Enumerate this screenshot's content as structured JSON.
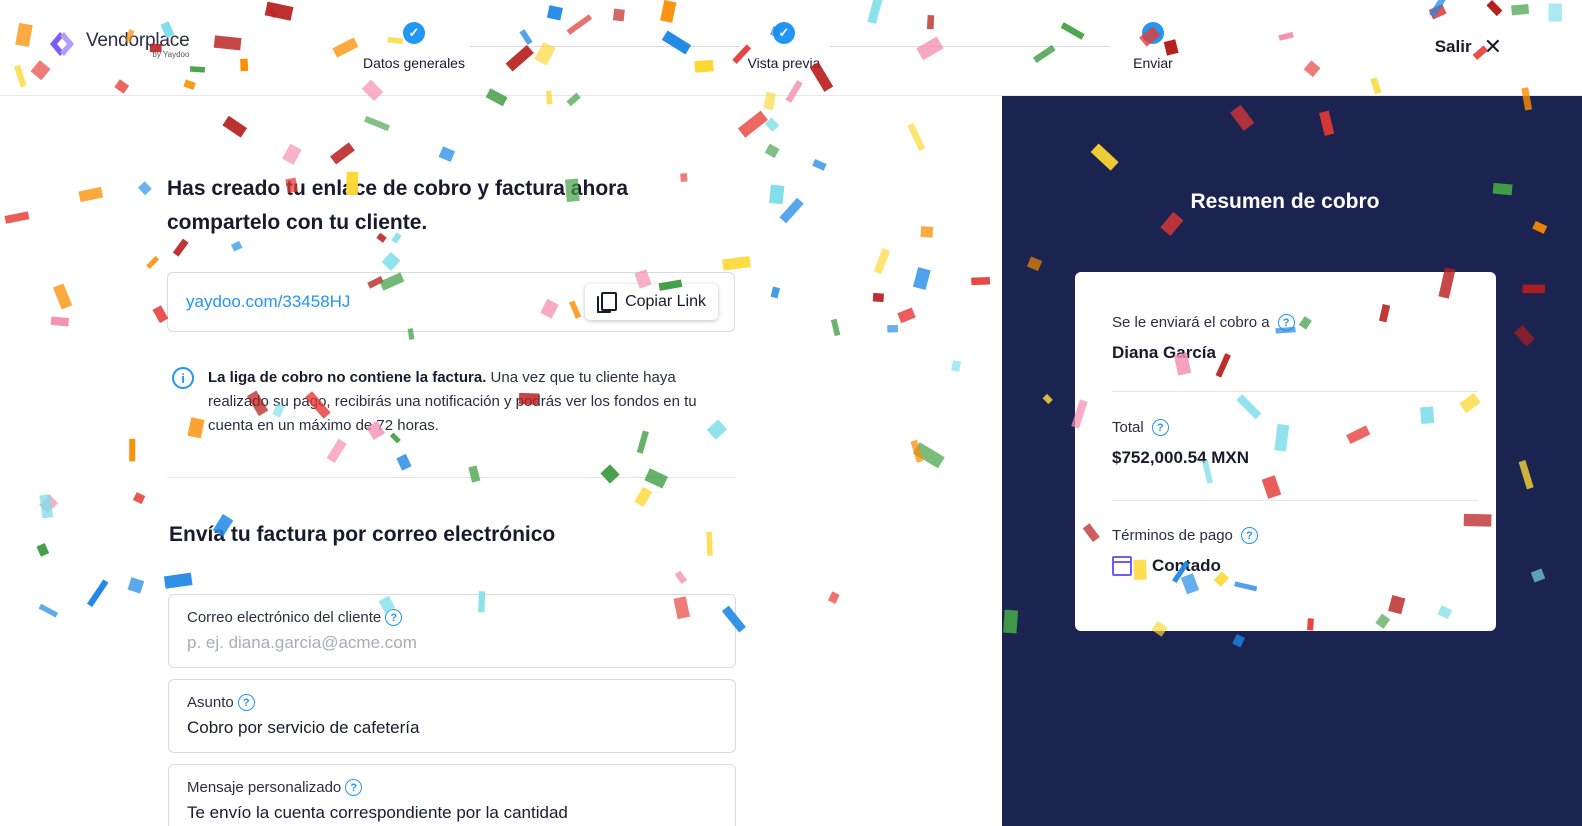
{
  "brand": {
    "name": "Vendorplace",
    "by": "by Yaydoo",
    "logo_color": "#7b5cf6"
  },
  "stepper": {
    "steps": [
      {
        "label": "Datos generales",
        "state": "completed"
      },
      {
        "label": "Vista previa",
        "state": "completed"
      },
      {
        "label": "Enviar",
        "state": "current"
      }
    ],
    "check_icon": "check-icon"
  },
  "header": {
    "exit_label": "Salir",
    "exit_icon": "close-icon"
  },
  "main": {
    "title": "Has creado tu enlace de cobro y factura ahora compartelo con tu cliente.",
    "link": {
      "url": "yaydoo.com/33458HJ",
      "copy_label": "Copiar Link"
    },
    "notice": {
      "bold": "La liga de cobro no contiene la factura.",
      "text": " Una vez que tu cliente haya realizado su pago, recibirás una notificación y podrás ver los fondos en tu cuenta en un máximo de 72 horas."
    },
    "email_section": {
      "title": "Envía tu factura por correo electrónico",
      "email_field": {
        "label": "Correo electrónico del cliente",
        "placeholder": "p. ej. diana.garcia@acme.com",
        "value": ""
      },
      "subject_field": {
        "label": "Asunto",
        "value": "Cobro por servicio de cafetería"
      },
      "message_field": {
        "label": "Mensaje personalizado",
        "value": "Te envío la cuenta correspondiente por la cantidad"
      }
    }
  },
  "summary": {
    "title": "Resumen de cobro",
    "recipient_label": "Se le enviará el cobro a",
    "recipient_value": "Diana García",
    "total_label": "Total",
    "total_value": "$752,000.54 MXN",
    "terms_label": "Términos de pago",
    "terms_value": "Contado",
    "help_icon": "question-icon"
  },
  "colors": {
    "accent": "#2196f3",
    "summary_bg": "#1b2350",
    "calendar": "#6f5cf6",
    "confetti": [
      "#e53935",
      "#43a047",
      "#fdd835",
      "#1e88e5",
      "#f48fb1",
      "#80deea",
      "#b71c1c",
      "#fb8c00"
    ]
  }
}
